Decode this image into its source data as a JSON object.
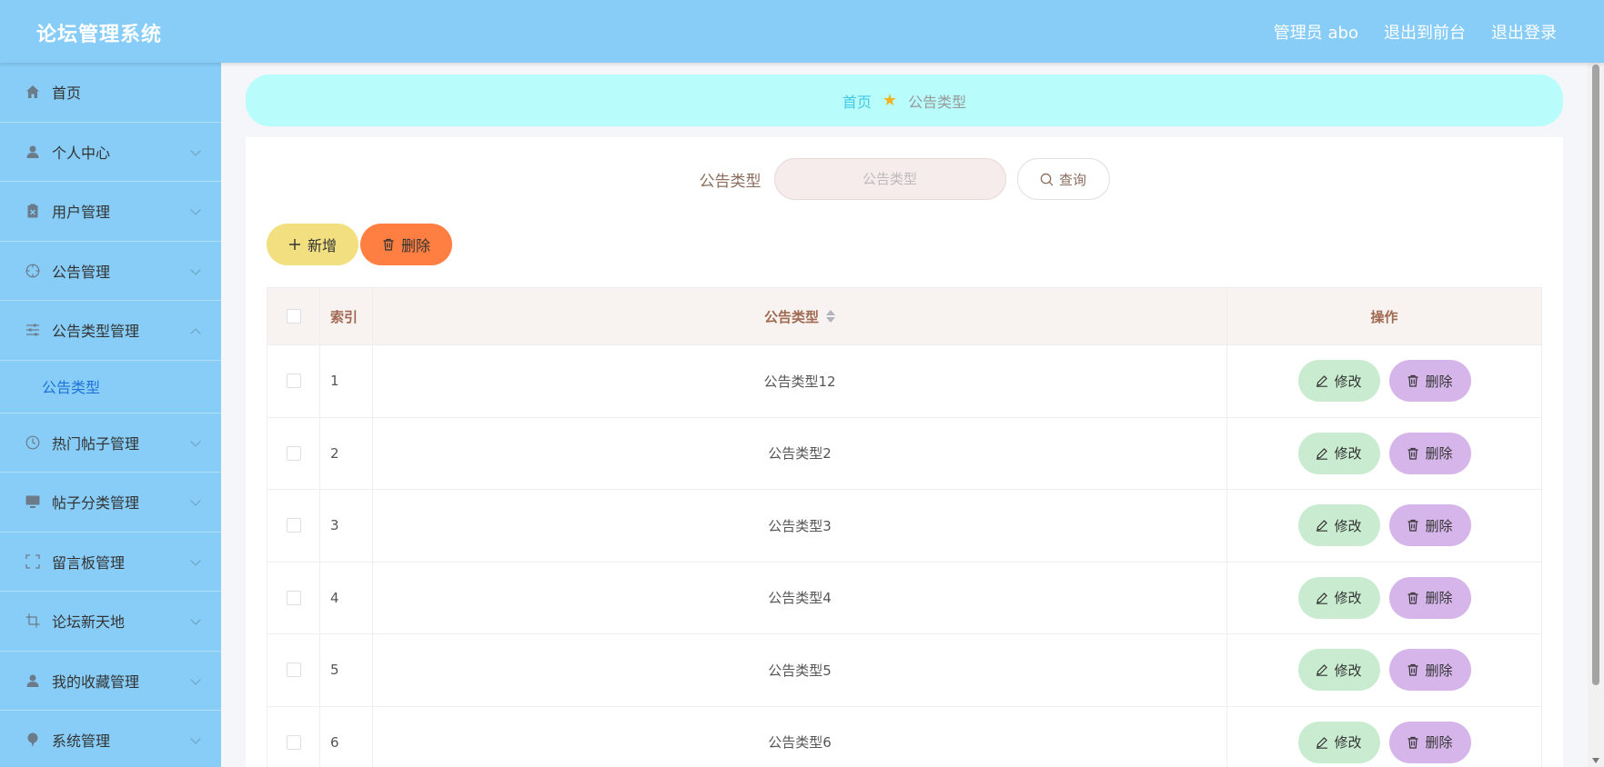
{
  "header": {
    "app_title": "论坛管理系统",
    "links": [
      "管理员 abo",
      "退出到前台",
      "退出登录"
    ]
  },
  "sidebar": {
    "items": [
      {
        "label": "首页",
        "icon": "home-icon"
      },
      {
        "label": "个人中心",
        "icon": "user-icon"
      },
      {
        "label": "用户管理",
        "icon": "clipboard-icon"
      },
      {
        "label": "公告管理",
        "icon": "target-icon"
      },
      {
        "label": "公告类型管理",
        "icon": "sliders-icon"
      },
      {
        "label": "公告类型",
        "icon": ""
      },
      {
        "label": "热门帖子管理",
        "icon": "clock-icon"
      },
      {
        "label": "帖子分类管理",
        "icon": "monitor-icon"
      },
      {
        "label": "留言板管理",
        "icon": "fullscreen-icon"
      },
      {
        "label": "论坛新天地",
        "icon": "crop-icon"
      },
      {
        "label": "我的收藏管理",
        "icon": "user-icon"
      },
      {
        "label": "系统管理",
        "icon": "pin-icon"
      }
    ]
  },
  "breadcrumb": {
    "home": "首页",
    "current": "公告类型"
  },
  "search": {
    "label": "公告类型",
    "placeholder": "公告类型",
    "button": "查询"
  },
  "actions": {
    "add": "新增",
    "delete": "删除"
  },
  "table": {
    "columns": [
      "索引",
      "公告类型",
      "操作"
    ],
    "rows": [
      {
        "index": "1",
        "type": "公告类型12"
      },
      {
        "index": "2",
        "type": "公告类型2"
      },
      {
        "index": "3",
        "type": "公告类型3"
      },
      {
        "index": "4",
        "type": "公告类型4"
      },
      {
        "index": "5",
        "type": "公告类型5"
      },
      {
        "index": "6",
        "type": "公告类型6"
      }
    ],
    "row_actions": {
      "edit": "修改",
      "delete": "删除"
    }
  },
  "colors": {
    "primary": "#87cdf7",
    "breadcrumb_bg": "#b8fdfb",
    "add_button": "#f1df80",
    "delete_button": "#ff7f42",
    "edit_button": "#c9ecd0",
    "row_delete_button": "#d6b6ea"
  }
}
